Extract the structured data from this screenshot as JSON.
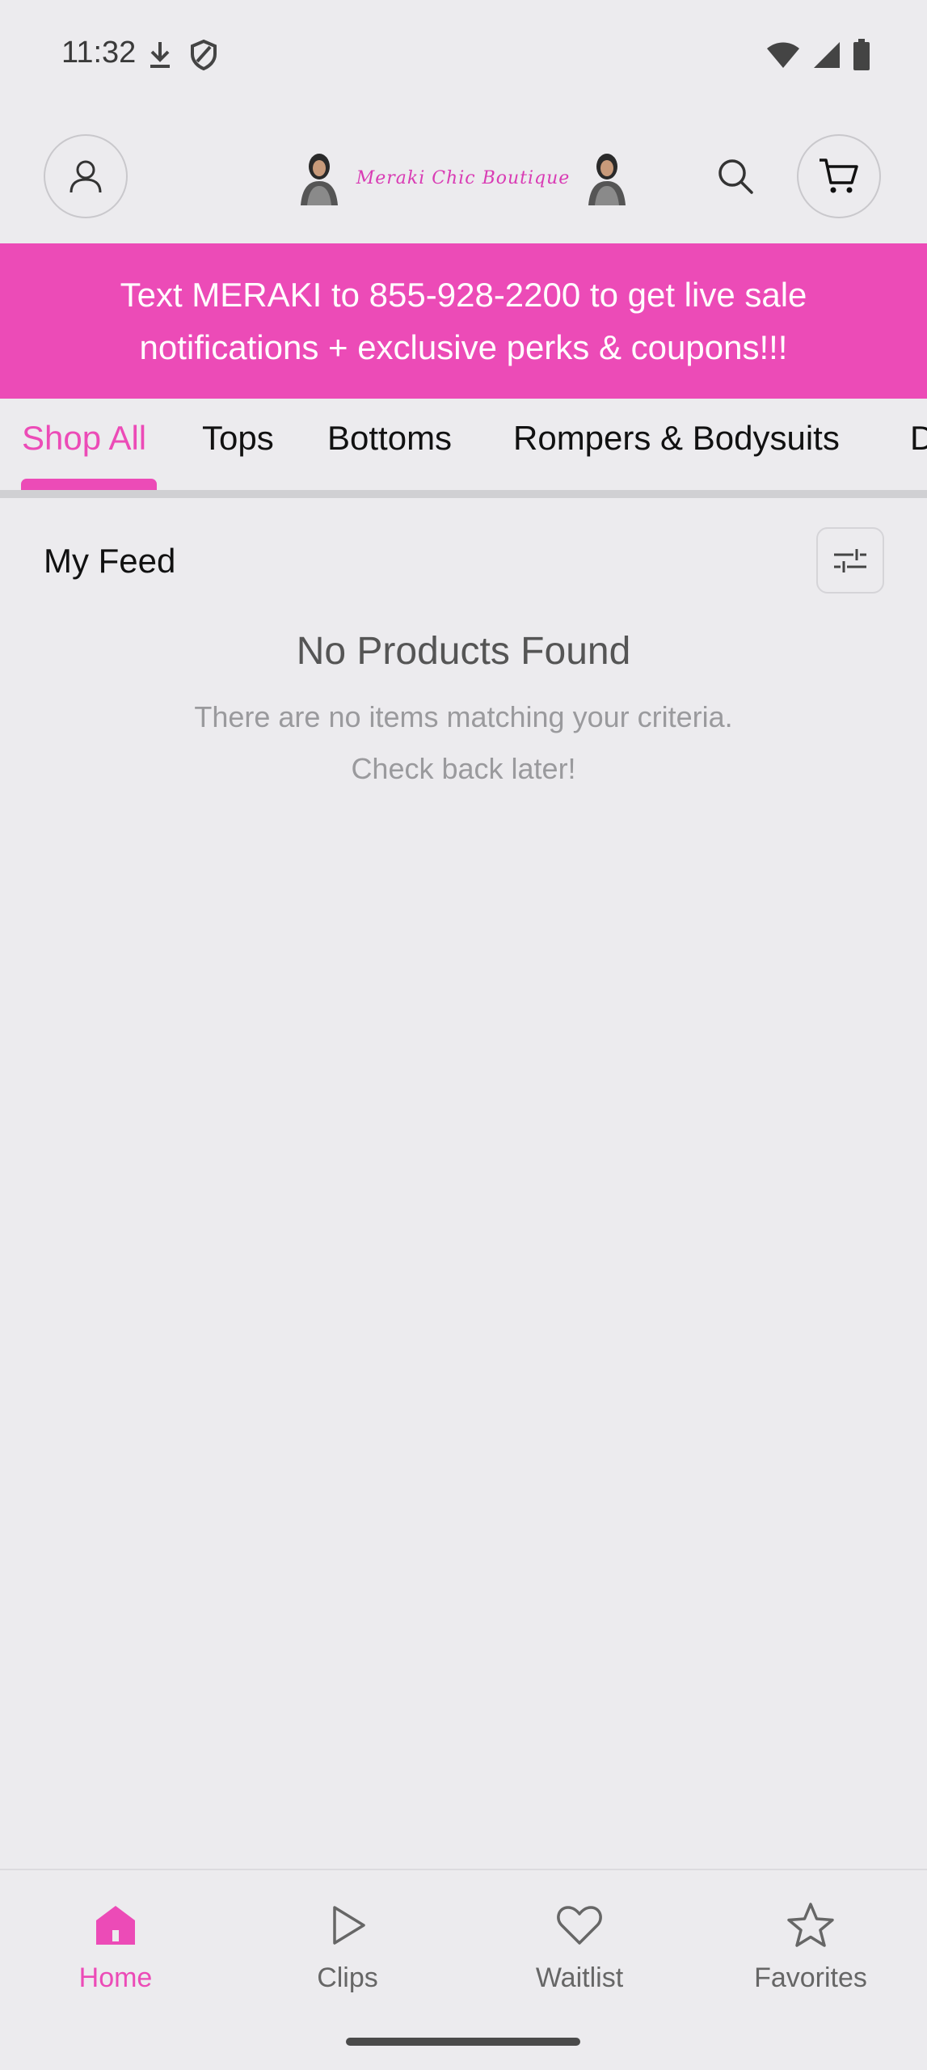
{
  "status_bar": {
    "time": "11:32",
    "left_icons": [
      "download-icon",
      "shield-icon"
    ],
    "right_icons": [
      "wifi-icon",
      "signal-icon",
      "battery-icon"
    ]
  },
  "header": {
    "logo_text": "Meraki Chic Boutique",
    "icons": [
      "account-icon",
      "search-icon",
      "cart-icon"
    ]
  },
  "promo": {
    "text": "Text MERAKI to 855-928-2200 to get live sale notifications + exclusive perks & coupons!!!"
  },
  "tabs": [
    {
      "label": "Shop All",
      "active": true
    },
    {
      "label": "Tops"
    },
    {
      "label": "Bottoms"
    },
    {
      "label": "Rompers & Bodysuits"
    },
    {
      "label": "D"
    }
  ],
  "feed": {
    "title": "My Feed",
    "filter_icon": "sliders-icon",
    "empty_title": "No Products Found",
    "empty_line1": "There are no items matching your criteria.",
    "empty_line2": "Check back later!"
  },
  "bottom_nav": [
    {
      "label": "Home",
      "icon": "home-icon",
      "active": true
    },
    {
      "label": "Clips",
      "icon": "play-icon"
    },
    {
      "label": "Waitlist",
      "icon": "heart-icon"
    },
    {
      "label": "Favorites",
      "icon": "star-icon"
    }
  ],
  "colors": {
    "accent": "#ec4bb7",
    "background": "#ecebee"
  }
}
